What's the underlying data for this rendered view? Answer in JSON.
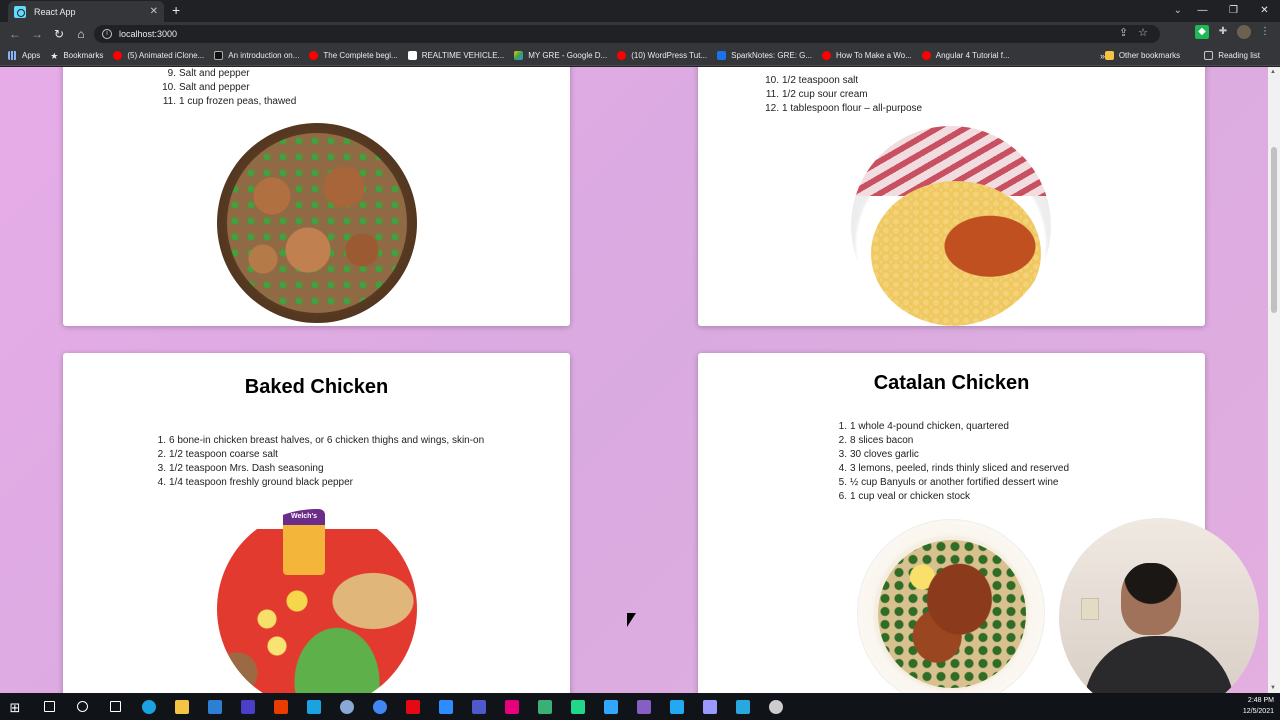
{
  "browser": {
    "tab_title": "React App",
    "url": "localhost:3000",
    "bookmarks": [
      {
        "label": "Apps",
        "icon": "apps-icon"
      },
      {
        "label": "Bookmarks",
        "icon": "star-icon"
      },
      {
        "label": "(5) Animated iClone...",
        "icon": "youtube-icon"
      },
      {
        "label": "An introduction on...",
        "icon": "terminal-icon"
      },
      {
        "label": "The Complete begi...",
        "icon": "youtube-icon"
      },
      {
        "label": "REALTIME VEHICLE...",
        "icon": "a-icon"
      },
      {
        "label": "MY GRE - Google D...",
        "icon": "drive-icon"
      },
      {
        "label": "(10) WordPress Tut...",
        "icon": "youtube-icon"
      },
      {
        "label": "SparkNotes: GRE: G...",
        "icon": "sparknotes-icon"
      },
      {
        "label": "How To Make a Wo...",
        "icon": "youtube-icon"
      },
      {
        "label": "Angular 4 Tutorial f...",
        "icon": "youtube-icon"
      }
    ],
    "more_bookmarks": "»",
    "other_bookmarks": "Other bookmarks",
    "reading_list": "Reading list"
  },
  "cards": {
    "top_left": {
      "ingredients": [
        {
          "num": "9.",
          "text": "Salt and pepper"
        },
        {
          "num": "10.",
          "text": "Salt and pepper"
        },
        {
          "num": "11.",
          "text": "1 cup frozen peas, thawed"
        }
      ]
    },
    "top_right": {
      "ingredients": [
        {
          "num": "10.",
          "text": "1/2 teaspoon salt"
        },
        {
          "num": "11.",
          "text": "1/2 cup sour cream"
        },
        {
          "num": "12.",
          "text": "1 tablespoon flour – all-purpose"
        }
      ]
    },
    "baked_chicken": {
      "title": "Baked Chicken",
      "ingredients": [
        {
          "num": "1.",
          "text": "6 bone-in chicken breast halves, or 6 chicken thighs and wings, skin-on"
        },
        {
          "num": "2.",
          "text": "1/2 teaspoon coarse salt"
        },
        {
          "num": "3.",
          "text": "1/2 teaspoon Mrs. Dash seasoning"
        },
        {
          "num": "4.",
          "text": "1/4 teaspoon freshly ground black pepper"
        }
      ]
    },
    "catalan_chicken": {
      "title": "Catalan Chicken",
      "ingredients": [
        {
          "num": "1.",
          "text": "1 whole 4-pound chicken, quartered"
        },
        {
          "num": "2.",
          "text": "8 slices bacon"
        },
        {
          "num": "3.",
          "text": "30 cloves garlic"
        },
        {
          "num": "4.",
          "text": "3 lemons, peeled, rinds thinly sliced and reserved"
        },
        {
          "num": "5.",
          "text": "½ cup Banyuls or another fortified dessert wine"
        },
        {
          "num": "6.",
          "text": "1 cup veal or chicken stock"
        }
      ]
    }
  },
  "taskbar": {
    "time": "2:48 PM",
    "date": "12/5/2021",
    "apps": [
      {
        "name": "search-icon",
        "color": "#ffffff"
      },
      {
        "name": "cortana-icon",
        "color": "#ffffff"
      },
      {
        "name": "task-view-icon",
        "color": "#ffffff"
      },
      {
        "name": "edge-icon",
        "color": "#1ba1e2"
      },
      {
        "name": "file-explorer-icon",
        "color": "#f4c542"
      },
      {
        "name": "store-icon",
        "color": "#2d7fd3"
      },
      {
        "name": "affinity-icon",
        "color": "#4a3fc6"
      },
      {
        "name": "office-icon",
        "color": "#eb3c00"
      },
      {
        "name": "app-icon",
        "color": "#1aa3e0"
      },
      {
        "name": "r-icon",
        "color": "#8aa8d6"
      },
      {
        "name": "chrome-icon",
        "color": "#4285f4"
      },
      {
        "name": "netflix-icon",
        "color": "#e50914"
      },
      {
        "name": "zoom-icon",
        "color": "#2d8cff"
      },
      {
        "name": "teams-icon",
        "color": "#5059c9"
      },
      {
        "name": "intellij-icon",
        "color": "#e7007d"
      },
      {
        "name": "app2-icon",
        "color": "#3ab077"
      },
      {
        "name": "pycharm-icon",
        "color": "#21d789"
      },
      {
        "name": "photoshop-icon",
        "color": "#31a8ff"
      },
      {
        "name": "visual-studio-icon",
        "color": "#865fc5"
      },
      {
        "name": "vscode-icon",
        "color": "#23a9f2"
      },
      {
        "name": "premiere-icon",
        "color": "#9999ff"
      },
      {
        "name": "app3-icon",
        "color": "#29a8e0"
      },
      {
        "name": "obs-icon",
        "color": "#cccccc"
      }
    ]
  }
}
